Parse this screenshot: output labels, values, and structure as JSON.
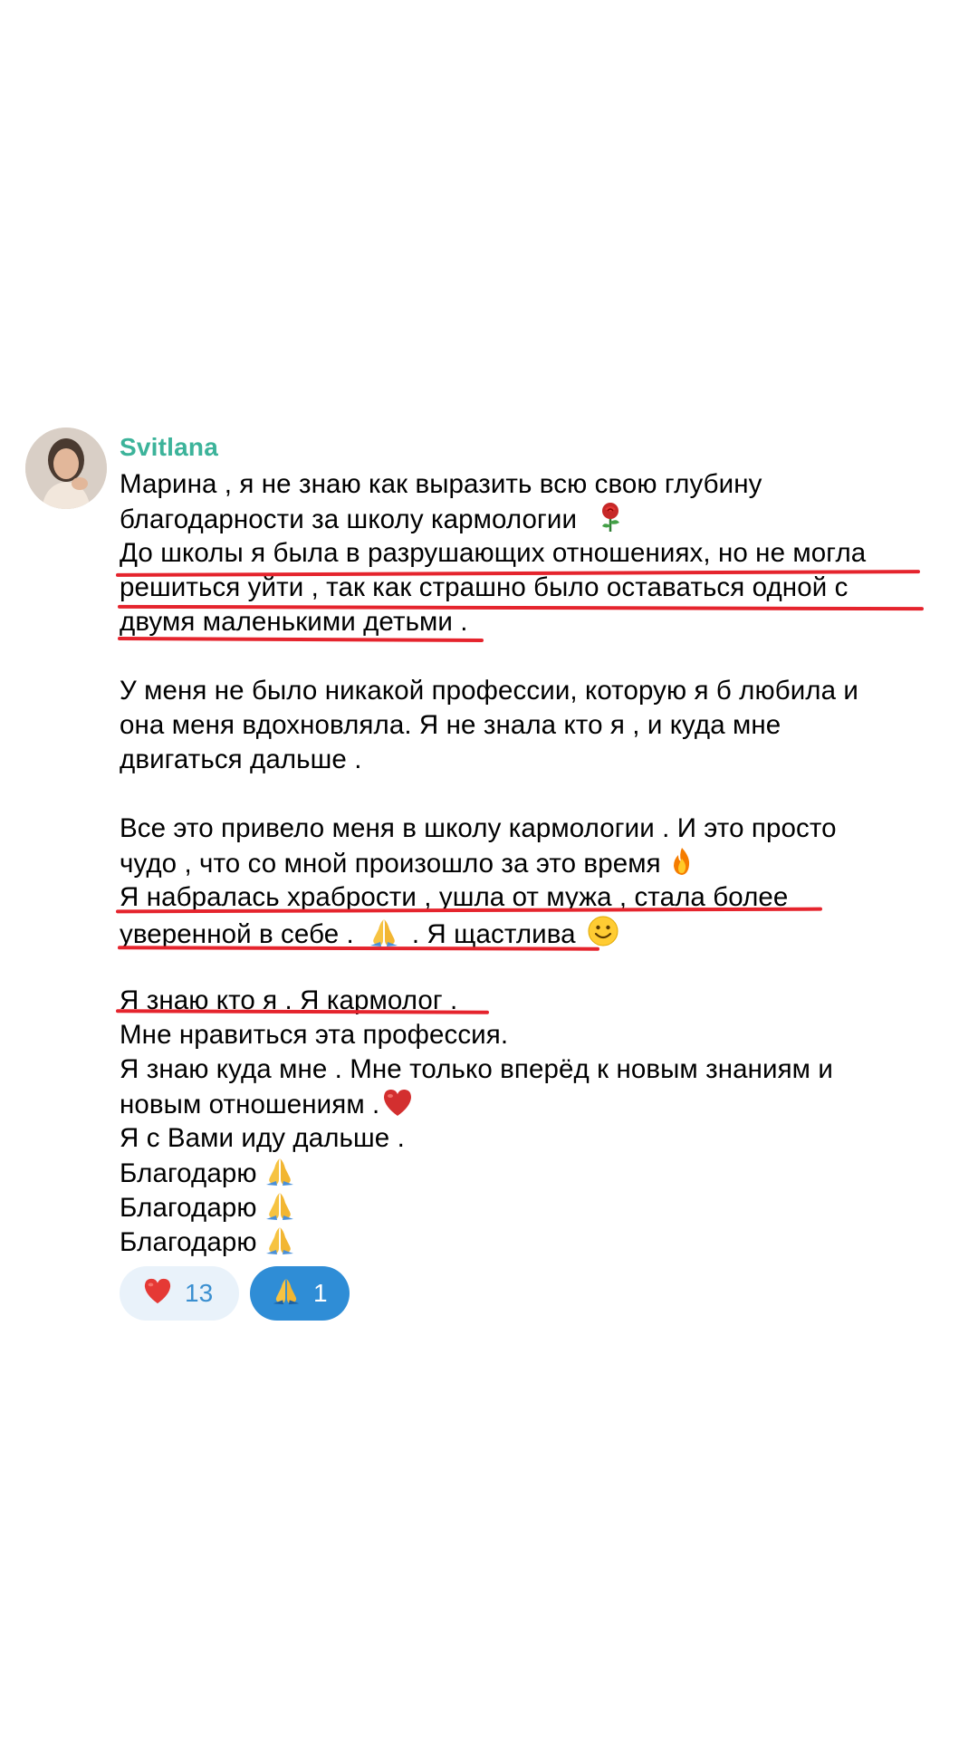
{
  "post": {
    "author": "Svitlana",
    "lines": [
      "Марина , я не знаю как выразить всю свою глубину",
      "благодарности за школу кармологии",
      "До школы я была в разрушающих отношениях, но не могла",
      "решиться уйти , так как страшно было оставаться одной с",
      "двумя маленькими детьми .",
      "",
      "У меня не было никакой профессии, которую я б любила и",
      "она меня вдохновляла.  Я не знала кто я , и куда мне",
      "двигаться дальше .",
      "",
      "Все это привело меня в школу кармологии . И это просто",
      "чудо , что со мной произошло за это время",
      "Я набралась храбрости , ушла от мужа , стала более",
      "уверенной в себе .",
      ". Я щастлива",
      "",
      "Я знаю кто я . Я кармолог .",
      "Мне нравиться эта профессия.",
      "Я знаю куда мне . Мне только вперёд к новым знаниям и",
      "новым отношениям .",
      "Я с Вами иду дальше .",
      "Благодарю",
      "Благодарю",
      "Благодарю"
    ],
    "emoji_icons": {
      "rose": "rose-icon",
      "fire": "fire-icon",
      "pray": "praying-hands-icon",
      "smile": "smiling-face-icon",
      "heart": "red-heart-icon"
    },
    "underline_color": "#e5242d",
    "author_color": "#3cb39a"
  },
  "reactions": [
    {
      "icon": "red-heart-icon",
      "count": "13",
      "selected": false
    },
    {
      "icon": "praying-hands-icon",
      "count": "1",
      "selected": true
    }
  ]
}
